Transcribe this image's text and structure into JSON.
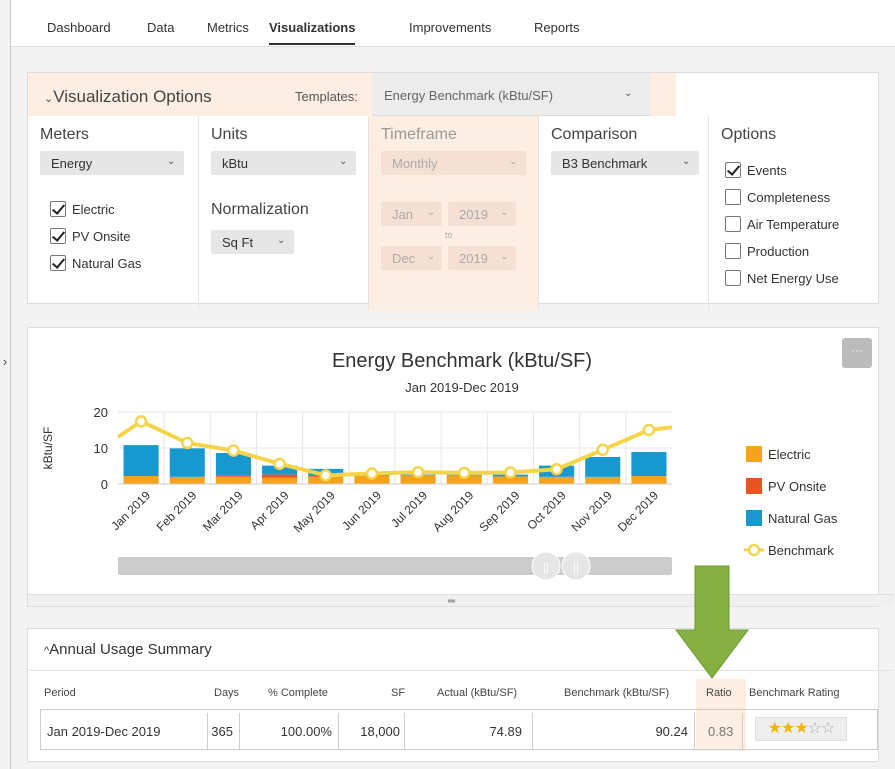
{
  "nav": {
    "tabs": [
      {
        "label": "Dashboard"
      },
      {
        "label": "Data"
      },
      {
        "label": "Metrics"
      },
      {
        "label": "Visualizations"
      },
      {
        "label": "Improvements"
      },
      {
        "label": "Reports"
      }
    ],
    "active": "Visualizations"
  },
  "viz_options": {
    "title": "Visualization Options",
    "templates_label": "Templates:",
    "template_value": "Energy Benchmark (kBtu/SF)",
    "meters": {
      "title": "Meters",
      "select": "Energy",
      "items": [
        {
          "label": "Electric",
          "checked": true
        },
        {
          "label": "PV Onsite",
          "checked": true
        },
        {
          "label": "Natural Gas",
          "checked": true
        }
      ]
    },
    "units": {
      "title": "Units",
      "select": "kBtu",
      "normalization_title": "Normalization",
      "normalization_select": "Sq Ft"
    },
    "timeframe": {
      "title": "Timeframe",
      "select": "Monthly",
      "from_month": "Jan",
      "from_year": "2019",
      "to_label": "to",
      "to_month": "Dec",
      "to_year": "2019"
    },
    "comparison": {
      "title": "Comparison",
      "select": "B3 Benchmark"
    },
    "options": {
      "title": "Options",
      "items": [
        {
          "label": "Events",
          "checked": true
        },
        {
          "label": "Completeness",
          "checked": false
        },
        {
          "label": "Air Temperature",
          "checked": false
        },
        {
          "label": "Production",
          "checked": false
        },
        {
          "label": "Net Energy Use",
          "checked": false
        }
      ]
    }
  },
  "chart_data": {
    "type": "bar",
    "title": "Energy Benchmark (kBtu/SF)",
    "subtitle": "Jan 2019-Dec 2019",
    "ylabel": "kBtu/SF",
    "ylim": [
      0,
      20
    ],
    "yticks": [
      0,
      10,
      20
    ],
    "categories": [
      "Jan 2019",
      "Feb 2019",
      "Mar 2019",
      "Apr 2019",
      "May 2019",
      "Jun 2019",
      "Jul 2019",
      "Aug 2019",
      "Sep 2019",
      "Oct 2019",
      "Nov 2019",
      "Dec 2019"
    ],
    "stacked": true,
    "series": [
      {
        "name": "Electric",
        "type": "bar",
        "color": "#f7a21b",
        "values": [
          2.2,
          2.0,
          2.0,
          1.8,
          2.0,
          2.3,
          2.4,
          2.4,
          2.1,
          2.0,
          2.0,
          2.2
        ]
      },
      {
        "name": "PV Onsite",
        "type": "bar",
        "color": "#ec5323",
        "values": [
          0,
          0,
          0.3,
          0.8,
          0.5,
          0,
          0,
          0,
          0,
          0,
          0,
          0
        ]
      },
      {
        "name": "Natural Gas",
        "type": "bar",
        "color": "#1798cf",
        "values": [
          8.6,
          7.9,
          6.3,
          2.5,
          1.7,
          0.3,
          0.2,
          0.2,
          0.5,
          3.1,
          5.5,
          6.7
        ]
      },
      {
        "name": "Benchmark",
        "type": "line",
        "color": "#f6d44a",
        "values": [
          17.4,
          11.4,
          9.3,
          5.6,
          2.4,
          2.9,
          3.3,
          3.1,
          3.2,
          4.1,
          9.5,
          15.0
        ]
      }
    ],
    "legend_position": "right"
  },
  "summary": {
    "title": "Annual Usage Summary",
    "headers": [
      "Period",
      "Days",
      "% Complete",
      "SF",
      "Actual (kBtu/SF)",
      "Benchmark (kBtu/SF)",
      "Ratio",
      "Benchmark Rating"
    ],
    "row": [
      "Jan 2019-Dec 2019",
      "365",
      "100.00%",
      "18,000",
      "74.89",
      "90.24",
      "0.83"
    ],
    "rating_stars": 3,
    "rating_max": 5
  },
  "colors": {
    "accent_peach": "#fdeee3",
    "arrow": "#86b043"
  }
}
